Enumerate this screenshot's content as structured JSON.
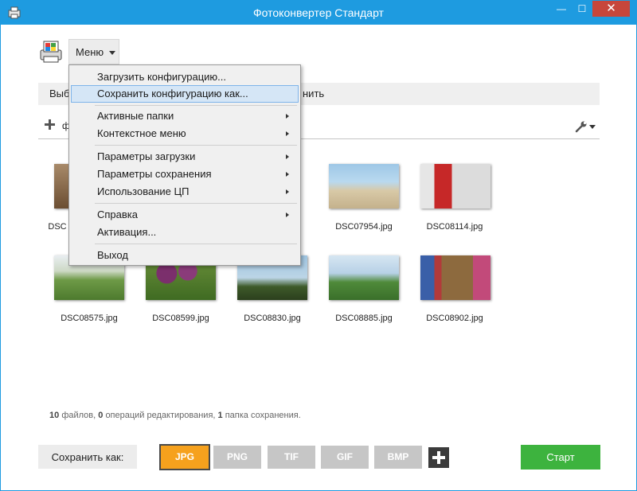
{
  "window": {
    "title": "Фотоконвертер Стандарт",
    "minimize_glyph": "—",
    "maximize_glyph": "☐",
    "close_glyph": "✕",
    "accent_color": "#1e9be0"
  },
  "header": {
    "menu_label": "Меню",
    "toolbar_left_text": "Выб",
    "toolbar_right_text": "нить",
    "add_row_partial": "ф"
  },
  "dropdown": {
    "items": [
      {
        "label": "Загрузить конфигурацию...",
        "submenu": false
      },
      {
        "label": "Сохранить конфигурацию как...",
        "submenu": false,
        "highlighted": true
      },
      {
        "label": "Активные папки",
        "submenu": true
      },
      {
        "label": "Контекстное меню",
        "submenu": true
      },
      {
        "label": "Параметры загрузки",
        "submenu": true
      },
      {
        "label": "Параметры сохранения",
        "submenu": true
      },
      {
        "label": "Использование ЦП",
        "submenu": true
      },
      {
        "label": "Справка",
        "submenu": true
      },
      {
        "label": "Активация...",
        "submenu": false
      },
      {
        "label": "Выход",
        "submenu": false
      }
    ]
  },
  "files": [
    {
      "name": "DSC"
    },
    {
      "name": ""
    },
    {
      "name": ""
    },
    {
      "name": "DSC07954.jpg"
    },
    {
      "name": "DSC08114.jpg"
    },
    {
      "name": "DSC08575.jpg"
    },
    {
      "name": "DSC08599.jpg"
    },
    {
      "name": "DSC08830.jpg"
    },
    {
      "name": "DSC08885.jpg"
    },
    {
      "name": "DSC08902.jpg"
    }
  ],
  "status": {
    "files_count": "10",
    "files_word": "файлов,",
    "ops_count": "0",
    "ops_word": "операций редактирования,",
    "folders_count": "1",
    "folders_word": "папка сохранения."
  },
  "footer": {
    "save_as_label": "Сохранить как:",
    "formats": [
      {
        "label": "JPG",
        "active": true
      },
      {
        "label": "PNG",
        "active": false
      },
      {
        "label": "TIF",
        "active": false
      },
      {
        "label": "GIF",
        "active": false
      },
      {
        "label": "BMP",
        "active": false
      }
    ],
    "start_label": "Старт",
    "active_format_color": "#f6a11d",
    "start_color": "#3db33e"
  }
}
